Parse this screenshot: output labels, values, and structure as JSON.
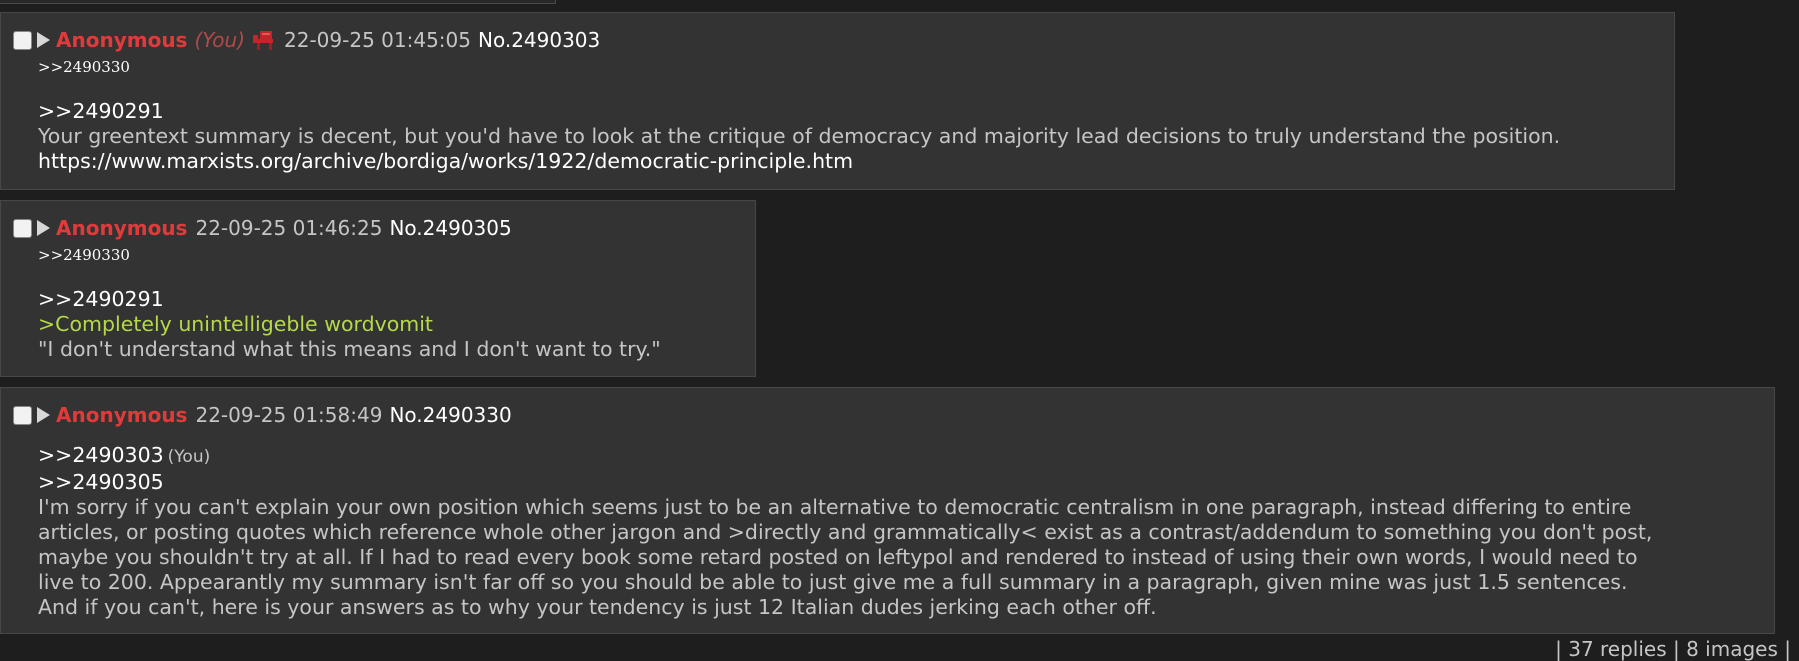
{
  "posts": [
    {
      "name": "Anonymous",
      "you_label": "(You)",
      "date": "22-09-25 01:45:05",
      "number": "No.2490303",
      "backlinks": ">>2490330",
      "lines": [
        ">>2490291",
        "Your greentext summary is decent, but you'd have to look at the critique of democracy and majority lead decisions to truly understand the position.",
        "https://www.marxists.org/archive/bordiga/works/1922/democratic-principle.htm"
      ]
    },
    {
      "name": "Anonymous",
      "date": "22-09-25 01:46:25",
      "number": "No.2490305",
      "backlinks": ">>2490330",
      "lines": [
        ">>2490291",
        ">Completely unintelligeble wordvomit",
        "\"I don't understand what this means and I don't want to try.\""
      ]
    },
    {
      "name": "Anonymous",
      "date": "22-09-25 01:58:49",
      "number": "No.2490330",
      "quote1": ">>2490303",
      "quote1_you": "(You)",
      "quote2": ">>2490305",
      "lines": [
        "I'm sorry if you can't explain your own position which seems just to be an alternative to democratic centralism in one paragraph, instead differing to entire",
        "articles, or posting quotes which reference whole other jargon and >directly and grammatically< exist as a contrast/addendum to something you don't post,",
        "maybe you shouldn't try at all. If I had to read every book some retard posted on leftypol and rendered to instead of using their own words, I would need to",
        "live to 200. Appearantly my summary isn't far off so you should be able to just give me a full summary in a paragraph, given mine was just 1.5 sentences.",
        "And if you can't, here is your answers as to why your tendency is just 12 Italian dudes jerking each other off."
      ]
    }
  ],
  "footer": "| 37 replies | 8 images |",
  "icons": {
    "flag": "chair-flag-icon"
  },
  "colors": {
    "name": "#e23a3a",
    "greentext": "#b5d94a",
    "background": "#1e1e1e",
    "post": "#333333"
  }
}
